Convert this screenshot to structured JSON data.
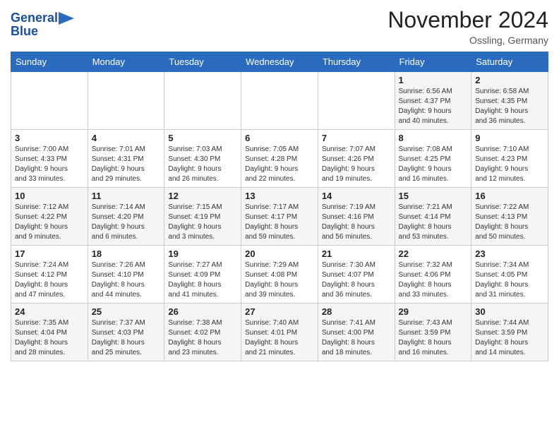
{
  "header": {
    "logo_line1": "General",
    "logo_line2": "Blue",
    "month_title": "November 2024",
    "location": "Ossling, Germany"
  },
  "days_of_week": [
    "Sunday",
    "Monday",
    "Tuesday",
    "Wednesday",
    "Thursday",
    "Friday",
    "Saturday"
  ],
  "weeks": [
    [
      {
        "day": "",
        "info": ""
      },
      {
        "day": "",
        "info": ""
      },
      {
        "day": "",
        "info": ""
      },
      {
        "day": "",
        "info": ""
      },
      {
        "day": "",
        "info": ""
      },
      {
        "day": "1",
        "info": "Sunrise: 6:56 AM\nSunset: 4:37 PM\nDaylight: 9 hours\nand 40 minutes."
      },
      {
        "day": "2",
        "info": "Sunrise: 6:58 AM\nSunset: 4:35 PM\nDaylight: 9 hours\nand 36 minutes."
      }
    ],
    [
      {
        "day": "3",
        "info": "Sunrise: 7:00 AM\nSunset: 4:33 PM\nDaylight: 9 hours\nand 33 minutes."
      },
      {
        "day": "4",
        "info": "Sunrise: 7:01 AM\nSunset: 4:31 PM\nDaylight: 9 hours\nand 29 minutes."
      },
      {
        "day": "5",
        "info": "Sunrise: 7:03 AM\nSunset: 4:30 PM\nDaylight: 9 hours\nand 26 minutes."
      },
      {
        "day": "6",
        "info": "Sunrise: 7:05 AM\nSunset: 4:28 PM\nDaylight: 9 hours\nand 22 minutes."
      },
      {
        "day": "7",
        "info": "Sunrise: 7:07 AM\nSunset: 4:26 PM\nDaylight: 9 hours\nand 19 minutes."
      },
      {
        "day": "8",
        "info": "Sunrise: 7:08 AM\nSunset: 4:25 PM\nDaylight: 9 hours\nand 16 minutes."
      },
      {
        "day": "9",
        "info": "Sunrise: 7:10 AM\nSunset: 4:23 PM\nDaylight: 9 hours\nand 12 minutes."
      }
    ],
    [
      {
        "day": "10",
        "info": "Sunrise: 7:12 AM\nSunset: 4:22 PM\nDaylight: 9 hours\nand 9 minutes."
      },
      {
        "day": "11",
        "info": "Sunrise: 7:14 AM\nSunset: 4:20 PM\nDaylight: 9 hours\nand 6 minutes."
      },
      {
        "day": "12",
        "info": "Sunrise: 7:15 AM\nSunset: 4:19 PM\nDaylight: 9 hours\nand 3 minutes."
      },
      {
        "day": "13",
        "info": "Sunrise: 7:17 AM\nSunset: 4:17 PM\nDaylight: 8 hours\nand 59 minutes."
      },
      {
        "day": "14",
        "info": "Sunrise: 7:19 AM\nSunset: 4:16 PM\nDaylight: 8 hours\nand 56 minutes."
      },
      {
        "day": "15",
        "info": "Sunrise: 7:21 AM\nSunset: 4:14 PM\nDaylight: 8 hours\nand 53 minutes."
      },
      {
        "day": "16",
        "info": "Sunrise: 7:22 AM\nSunset: 4:13 PM\nDaylight: 8 hours\nand 50 minutes."
      }
    ],
    [
      {
        "day": "17",
        "info": "Sunrise: 7:24 AM\nSunset: 4:12 PM\nDaylight: 8 hours\nand 47 minutes."
      },
      {
        "day": "18",
        "info": "Sunrise: 7:26 AM\nSunset: 4:10 PM\nDaylight: 8 hours\nand 44 minutes."
      },
      {
        "day": "19",
        "info": "Sunrise: 7:27 AM\nSunset: 4:09 PM\nDaylight: 8 hours\nand 41 minutes."
      },
      {
        "day": "20",
        "info": "Sunrise: 7:29 AM\nSunset: 4:08 PM\nDaylight: 8 hours\nand 39 minutes."
      },
      {
        "day": "21",
        "info": "Sunrise: 7:30 AM\nSunset: 4:07 PM\nDaylight: 8 hours\nand 36 minutes."
      },
      {
        "day": "22",
        "info": "Sunrise: 7:32 AM\nSunset: 4:06 PM\nDaylight: 8 hours\nand 33 minutes."
      },
      {
        "day": "23",
        "info": "Sunrise: 7:34 AM\nSunset: 4:05 PM\nDaylight: 8 hours\nand 31 minutes."
      }
    ],
    [
      {
        "day": "24",
        "info": "Sunrise: 7:35 AM\nSunset: 4:04 PM\nDaylight: 8 hours\nand 28 minutes."
      },
      {
        "day": "25",
        "info": "Sunrise: 7:37 AM\nSunset: 4:03 PM\nDaylight: 8 hours\nand 25 minutes."
      },
      {
        "day": "26",
        "info": "Sunrise: 7:38 AM\nSunset: 4:02 PM\nDaylight: 8 hours\nand 23 minutes."
      },
      {
        "day": "27",
        "info": "Sunrise: 7:40 AM\nSunset: 4:01 PM\nDaylight: 8 hours\nand 21 minutes."
      },
      {
        "day": "28",
        "info": "Sunrise: 7:41 AM\nSunset: 4:00 PM\nDaylight: 8 hours\nand 18 minutes."
      },
      {
        "day": "29",
        "info": "Sunrise: 7:43 AM\nSunset: 3:59 PM\nDaylight: 8 hours\nand 16 minutes."
      },
      {
        "day": "30",
        "info": "Sunrise: 7:44 AM\nSunset: 3:59 PM\nDaylight: 8 hours\nand 14 minutes."
      }
    ]
  ]
}
